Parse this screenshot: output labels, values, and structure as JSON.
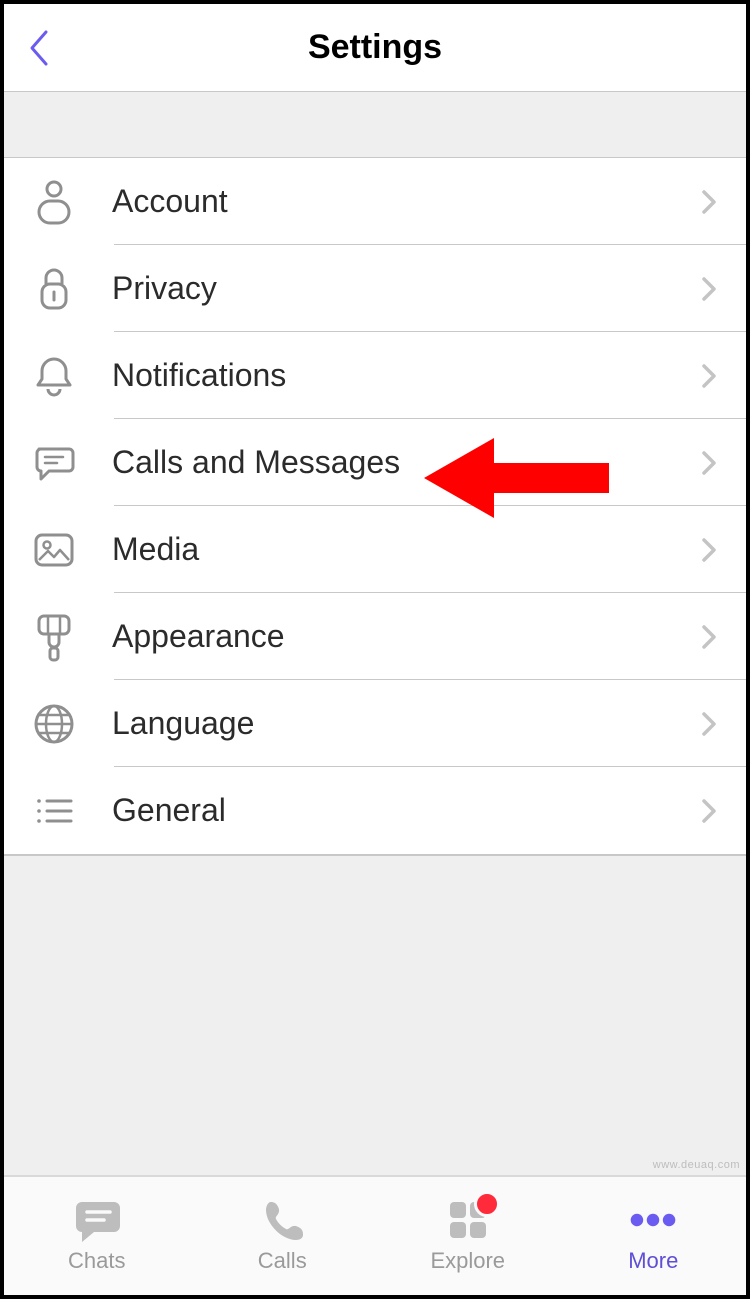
{
  "header": {
    "title": "Settings"
  },
  "settings_items": [
    {
      "id": "account",
      "label": "Account",
      "icon": "person-icon"
    },
    {
      "id": "privacy",
      "label": "Privacy",
      "icon": "lock-icon"
    },
    {
      "id": "notifications",
      "label": "Notifications",
      "icon": "bell-icon"
    },
    {
      "id": "calls-msgs",
      "label": "Calls and Messages",
      "icon": "chat-icon"
    },
    {
      "id": "media",
      "label": "Media",
      "icon": "picture-icon"
    },
    {
      "id": "appearance",
      "label": "Appearance",
      "icon": "brush-icon"
    },
    {
      "id": "language",
      "label": "Language",
      "icon": "globe-icon"
    },
    {
      "id": "general",
      "label": "General",
      "icon": "list-icon"
    }
  ],
  "annotation": {
    "highlight_index": 3,
    "color": "#ff0000"
  },
  "tabs": {
    "items": [
      {
        "label": "Chats",
        "icon": "chat-bubble-icon"
      },
      {
        "label": "Calls",
        "icon": "phone-icon"
      },
      {
        "label": "Explore",
        "icon": "grid-icon",
        "badge": true
      },
      {
        "label": "More",
        "icon": "more-dots-icon",
        "active": true
      }
    ]
  },
  "watermark": "www.deuaq.com"
}
